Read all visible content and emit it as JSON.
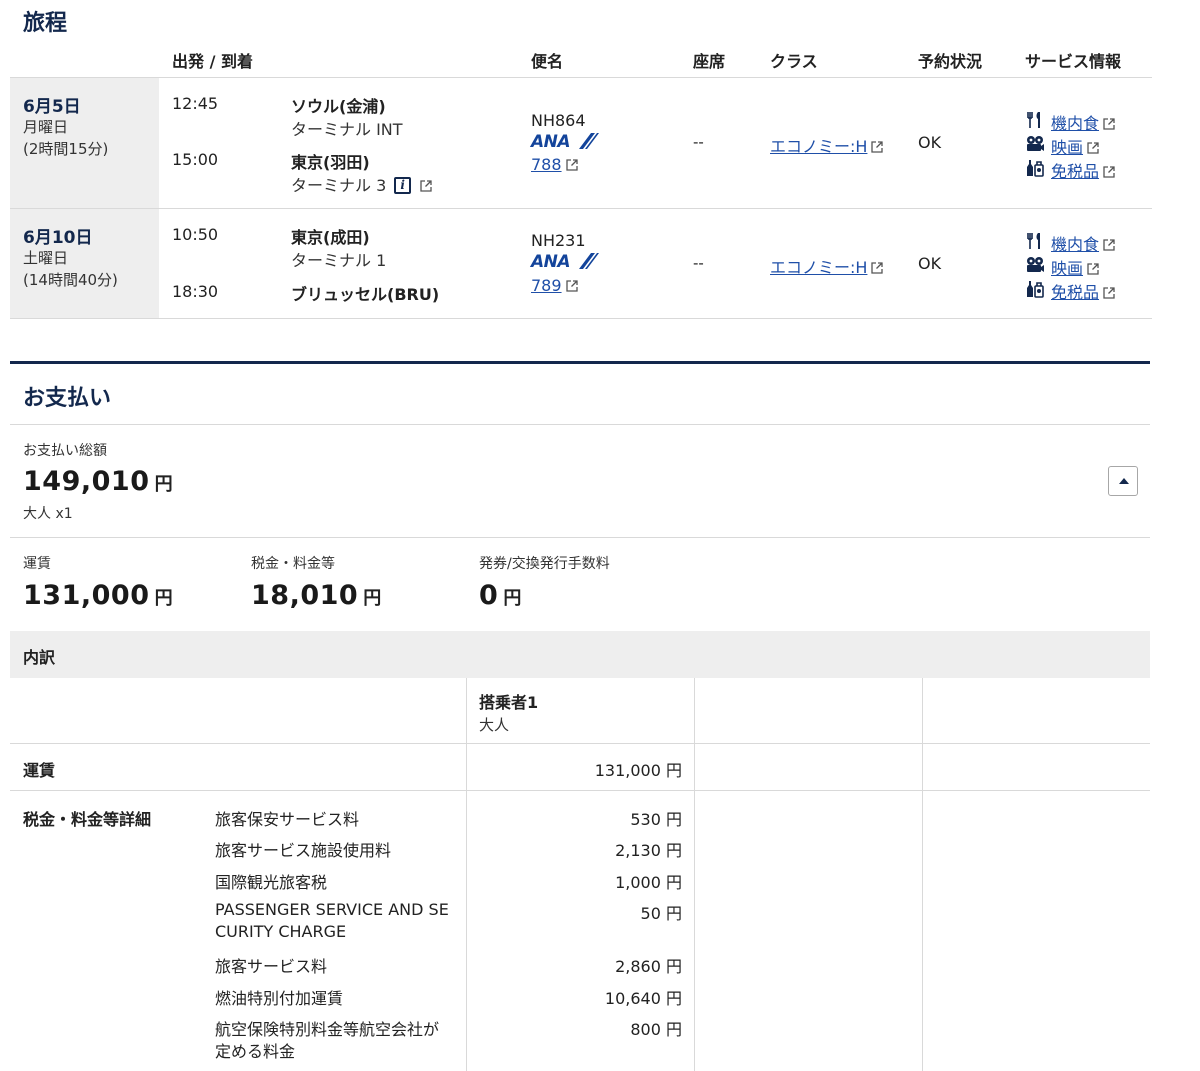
{
  "itinerary": {
    "title": "旅程",
    "headers": {
      "dep_arr": "出発 / 到着",
      "flight": "便名",
      "seat": "座席",
      "class": "クラス",
      "status": "予約状況",
      "service": "サービス情報"
    },
    "segments": [
      {
        "date": "6月5日",
        "weekday": "月曜日",
        "duration": "(2時間15分)",
        "dep_time": "12:45",
        "dep_place": "ソウル(金浦)",
        "dep_terminal": "ターミナル INT",
        "arr_time": "15:00",
        "arr_place": "東京(羽田)",
        "arr_terminal": "ターミナル 3",
        "flight_no": "NH864",
        "airline": "ANA",
        "aircraft": "788",
        "seat": "--",
        "class": "エコノミー:H",
        "status": "OK",
        "services": [
          "機内食",
          "映画",
          "免税品"
        ]
      },
      {
        "date": "6月10日",
        "weekday": "土曜日",
        "duration": "(14時間40分)",
        "dep_time": "10:50",
        "dep_place": "東京(成田)",
        "dep_terminal": "ターミナル 1",
        "arr_time": "18:30",
        "arr_place": "ブリュッセル(BRU)",
        "flight_no": "NH231",
        "airline": "ANA",
        "aircraft": "789",
        "seat": "--",
        "class": "エコノミー:H",
        "status": "OK",
        "services": [
          "機内食",
          "映画",
          "免税品"
        ]
      }
    ]
  },
  "payment": {
    "title": "お支払い",
    "total_label": "お支払い総額",
    "total_amount": "149,010",
    "currency": "円",
    "pax_summary": "大人 x1",
    "fare_label": "運賃",
    "fare_amount": "131,000",
    "tax_label": "税金・料金等",
    "tax_amount": "18,010",
    "fee_label": "発券/交換発行手数料",
    "fee_amount": "0",
    "breakdown": {
      "title": "内訳",
      "passenger": "搭乗者1",
      "passenger_type": "大人",
      "fare_row_label": "運賃",
      "fare_row_value": "131,000 円",
      "tax_detail_label": "税金・料金等詳細",
      "taxes": [
        {
          "name": "旅客保安サービス料",
          "value": "530 円"
        },
        {
          "name": "旅客サービス施設使用料",
          "value": "2,130 円"
        },
        {
          "name": "国際観光旅客税",
          "value": "1,000 円"
        },
        {
          "name": "PASSENGER SERVICE AND SE",
          "name2": "CURITY CHARGE",
          "value": "50 円"
        },
        {
          "name": "旅客サービス料",
          "value": "2,860 円"
        },
        {
          "name": "燃油特別付加運賃",
          "value": "10,640 円"
        },
        {
          "name": "航空保険特別料金等航空会社が",
          "name2": "定める料金",
          "value": "800 円"
        }
      ]
    }
  },
  "colors": {
    "navy": "#13284d",
    "link": "#1f4fa8",
    "gray_bg": "#eeeeee"
  }
}
